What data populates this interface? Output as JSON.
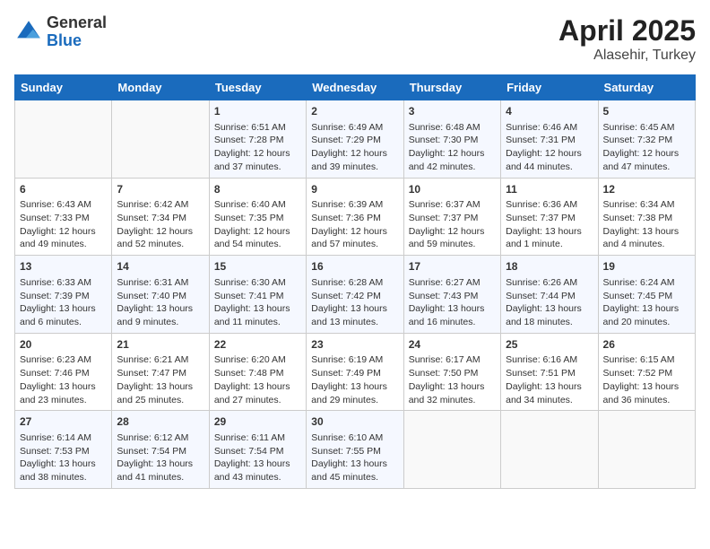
{
  "logo": {
    "general": "General",
    "blue": "Blue"
  },
  "title": {
    "month": "April 2025",
    "location": "Alasehir, Turkey"
  },
  "weekdays": [
    "Sunday",
    "Monday",
    "Tuesday",
    "Wednesday",
    "Thursday",
    "Friday",
    "Saturday"
  ],
  "weeks": [
    [
      {
        "day": "",
        "info": ""
      },
      {
        "day": "",
        "info": ""
      },
      {
        "day": "1",
        "info": "Sunrise: 6:51 AM\nSunset: 7:28 PM\nDaylight: 12 hours and 37 minutes."
      },
      {
        "day": "2",
        "info": "Sunrise: 6:49 AM\nSunset: 7:29 PM\nDaylight: 12 hours and 39 minutes."
      },
      {
        "day": "3",
        "info": "Sunrise: 6:48 AM\nSunset: 7:30 PM\nDaylight: 12 hours and 42 minutes."
      },
      {
        "day": "4",
        "info": "Sunrise: 6:46 AM\nSunset: 7:31 PM\nDaylight: 12 hours and 44 minutes."
      },
      {
        "day": "5",
        "info": "Sunrise: 6:45 AM\nSunset: 7:32 PM\nDaylight: 12 hours and 47 minutes."
      }
    ],
    [
      {
        "day": "6",
        "info": "Sunrise: 6:43 AM\nSunset: 7:33 PM\nDaylight: 12 hours and 49 minutes."
      },
      {
        "day": "7",
        "info": "Sunrise: 6:42 AM\nSunset: 7:34 PM\nDaylight: 12 hours and 52 minutes."
      },
      {
        "day": "8",
        "info": "Sunrise: 6:40 AM\nSunset: 7:35 PM\nDaylight: 12 hours and 54 minutes."
      },
      {
        "day": "9",
        "info": "Sunrise: 6:39 AM\nSunset: 7:36 PM\nDaylight: 12 hours and 57 minutes."
      },
      {
        "day": "10",
        "info": "Sunrise: 6:37 AM\nSunset: 7:37 PM\nDaylight: 12 hours and 59 minutes."
      },
      {
        "day": "11",
        "info": "Sunrise: 6:36 AM\nSunset: 7:37 PM\nDaylight: 13 hours and 1 minute."
      },
      {
        "day": "12",
        "info": "Sunrise: 6:34 AM\nSunset: 7:38 PM\nDaylight: 13 hours and 4 minutes."
      }
    ],
    [
      {
        "day": "13",
        "info": "Sunrise: 6:33 AM\nSunset: 7:39 PM\nDaylight: 13 hours and 6 minutes."
      },
      {
        "day": "14",
        "info": "Sunrise: 6:31 AM\nSunset: 7:40 PM\nDaylight: 13 hours and 9 minutes."
      },
      {
        "day": "15",
        "info": "Sunrise: 6:30 AM\nSunset: 7:41 PM\nDaylight: 13 hours and 11 minutes."
      },
      {
        "day": "16",
        "info": "Sunrise: 6:28 AM\nSunset: 7:42 PM\nDaylight: 13 hours and 13 minutes."
      },
      {
        "day": "17",
        "info": "Sunrise: 6:27 AM\nSunset: 7:43 PM\nDaylight: 13 hours and 16 minutes."
      },
      {
        "day": "18",
        "info": "Sunrise: 6:26 AM\nSunset: 7:44 PM\nDaylight: 13 hours and 18 minutes."
      },
      {
        "day": "19",
        "info": "Sunrise: 6:24 AM\nSunset: 7:45 PM\nDaylight: 13 hours and 20 minutes."
      }
    ],
    [
      {
        "day": "20",
        "info": "Sunrise: 6:23 AM\nSunset: 7:46 PM\nDaylight: 13 hours and 23 minutes."
      },
      {
        "day": "21",
        "info": "Sunrise: 6:21 AM\nSunset: 7:47 PM\nDaylight: 13 hours and 25 minutes."
      },
      {
        "day": "22",
        "info": "Sunrise: 6:20 AM\nSunset: 7:48 PM\nDaylight: 13 hours and 27 minutes."
      },
      {
        "day": "23",
        "info": "Sunrise: 6:19 AM\nSunset: 7:49 PM\nDaylight: 13 hours and 29 minutes."
      },
      {
        "day": "24",
        "info": "Sunrise: 6:17 AM\nSunset: 7:50 PM\nDaylight: 13 hours and 32 minutes."
      },
      {
        "day": "25",
        "info": "Sunrise: 6:16 AM\nSunset: 7:51 PM\nDaylight: 13 hours and 34 minutes."
      },
      {
        "day": "26",
        "info": "Sunrise: 6:15 AM\nSunset: 7:52 PM\nDaylight: 13 hours and 36 minutes."
      }
    ],
    [
      {
        "day": "27",
        "info": "Sunrise: 6:14 AM\nSunset: 7:53 PM\nDaylight: 13 hours and 38 minutes."
      },
      {
        "day": "28",
        "info": "Sunrise: 6:12 AM\nSunset: 7:54 PM\nDaylight: 13 hours and 41 minutes."
      },
      {
        "day": "29",
        "info": "Sunrise: 6:11 AM\nSunset: 7:54 PM\nDaylight: 13 hours and 43 minutes."
      },
      {
        "day": "30",
        "info": "Sunrise: 6:10 AM\nSunset: 7:55 PM\nDaylight: 13 hours and 45 minutes."
      },
      {
        "day": "",
        "info": ""
      },
      {
        "day": "",
        "info": ""
      },
      {
        "day": "",
        "info": ""
      }
    ]
  ]
}
